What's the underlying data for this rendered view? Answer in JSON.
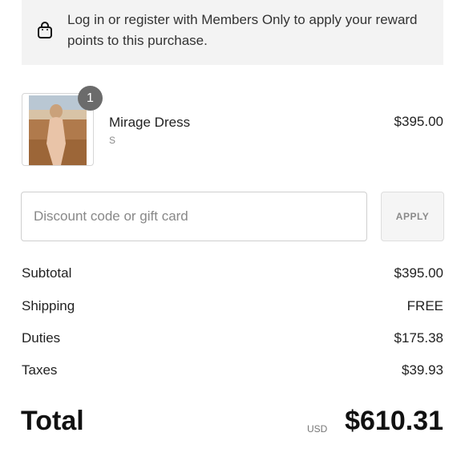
{
  "members_banner": {
    "icon": "shopping-bag-icon",
    "text": "Log in or register with Members Only to apply your reward points to this purchase."
  },
  "cart_item": {
    "quantity": "1",
    "name": "Mirage Dress",
    "variant": "S",
    "price": "$395.00"
  },
  "discount": {
    "placeholder": "Discount code or gift card",
    "value": "",
    "apply_label": "APPLY"
  },
  "summary": {
    "subtotal_label": "Subtotal",
    "subtotal_value": "$395.00",
    "shipping_label": "Shipping",
    "shipping_value": "FREE",
    "duties_label": "Duties",
    "duties_value": "$175.38",
    "taxes_label": "Taxes",
    "taxes_value": "$39.93"
  },
  "total": {
    "label": "Total",
    "currency": "USD",
    "amount": "$610.31"
  },
  "colors": {
    "banner_bg": "#f3f3f3",
    "badge_bg": "#6b6b6b",
    "text": "#222222",
    "muted": "#8a8a8a"
  }
}
